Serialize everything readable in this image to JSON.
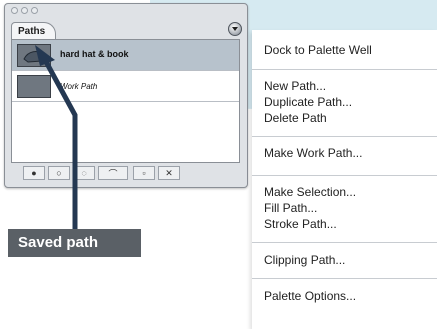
{
  "palette": {
    "tab_label": "Paths",
    "rows": [
      {
        "label": "hard hat & book",
        "selected": true
      },
      {
        "label": "Work Path",
        "selected": false
      }
    ],
    "tools": [
      "fill-path-icon",
      "stroke-path-icon",
      "load-selection-icon",
      "make-work-path-icon",
      "new-path-icon",
      "trash-icon"
    ]
  },
  "context_menu": {
    "items": [
      "Dock to Palette Well",
      "New Path...",
      "Duplicate Path...",
      "Delete Path",
      "Make Work Path...",
      "Make Selection...",
      "Fill Path...",
      "Stroke Path...",
      "Clipping Path...",
      "Palette Options..."
    ]
  },
  "callout": {
    "label": "Saved path"
  },
  "colors": {
    "background_wave": "#d6eaf1",
    "callout_box": "#5a6066",
    "callout_line": "#243852",
    "selected_row": "#b7c2cc"
  }
}
